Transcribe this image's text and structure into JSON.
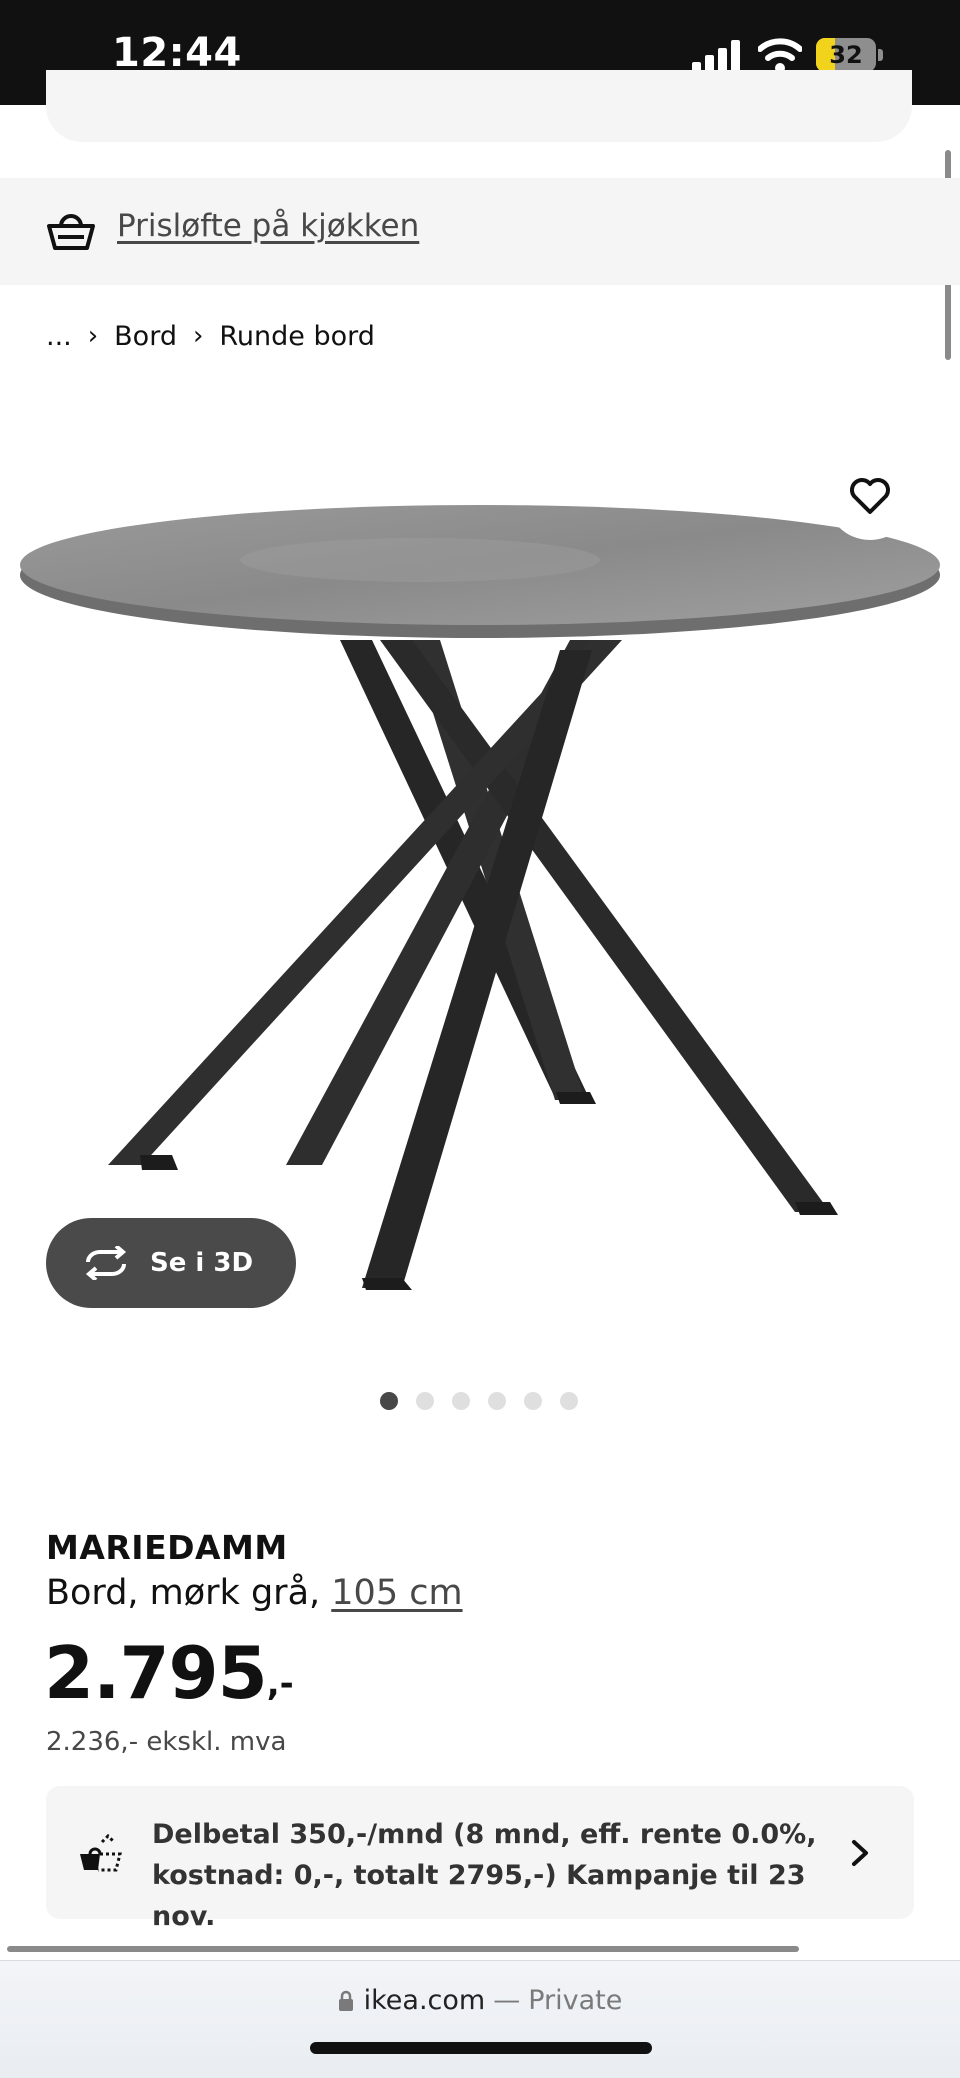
{
  "status_bar": {
    "time": "12:44",
    "battery": "32",
    "battery_level_percent": 32,
    "icons": [
      "cellular-signal-icon",
      "wifi-icon",
      "battery-charging-icon"
    ]
  },
  "promo": {
    "icon": "basket-icon",
    "link_text": "Prisløfte på kjøkken"
  },
  "breadcrumb": {
    "items": [
      "...",
      "Bord",
      "Runde bord"
    ]
  },
  "gallery": {
    "view_3d_label": "Se i 3D",
    "dot_count": 6,
    "active_index": 0
  },
  "product": {
    "name": "MARIEDAMM",
    "description": "Bord, mørk grå,",
    "size": "105 cm",
    "price": "2.795",
    "price_suffix": ",-",
    "price_ex_vat": "2.236,- ekskl. mva"
  },
  "financing": {
    "text": "Delbetal 350,-/mnd (8 mnd, eff. rente 0.0%, kostnad: 0,-, totalt 2795,-) Kampanje til 23 nov."
  },
  "browser": {
    "domain": "ikea.com",
    "separator": "—",
    "mode": "Private"
  },
  "colors": {
    "status_bar": "#111111",
    "panel_grey": "#f5f5f5",
    "button_dark": "#4a4a4a",
    "battery_yellow": "#f2d31b",
    "table_top": "#8f8f8f",
    "table_legs": "#2b2b2b"
  }
}
